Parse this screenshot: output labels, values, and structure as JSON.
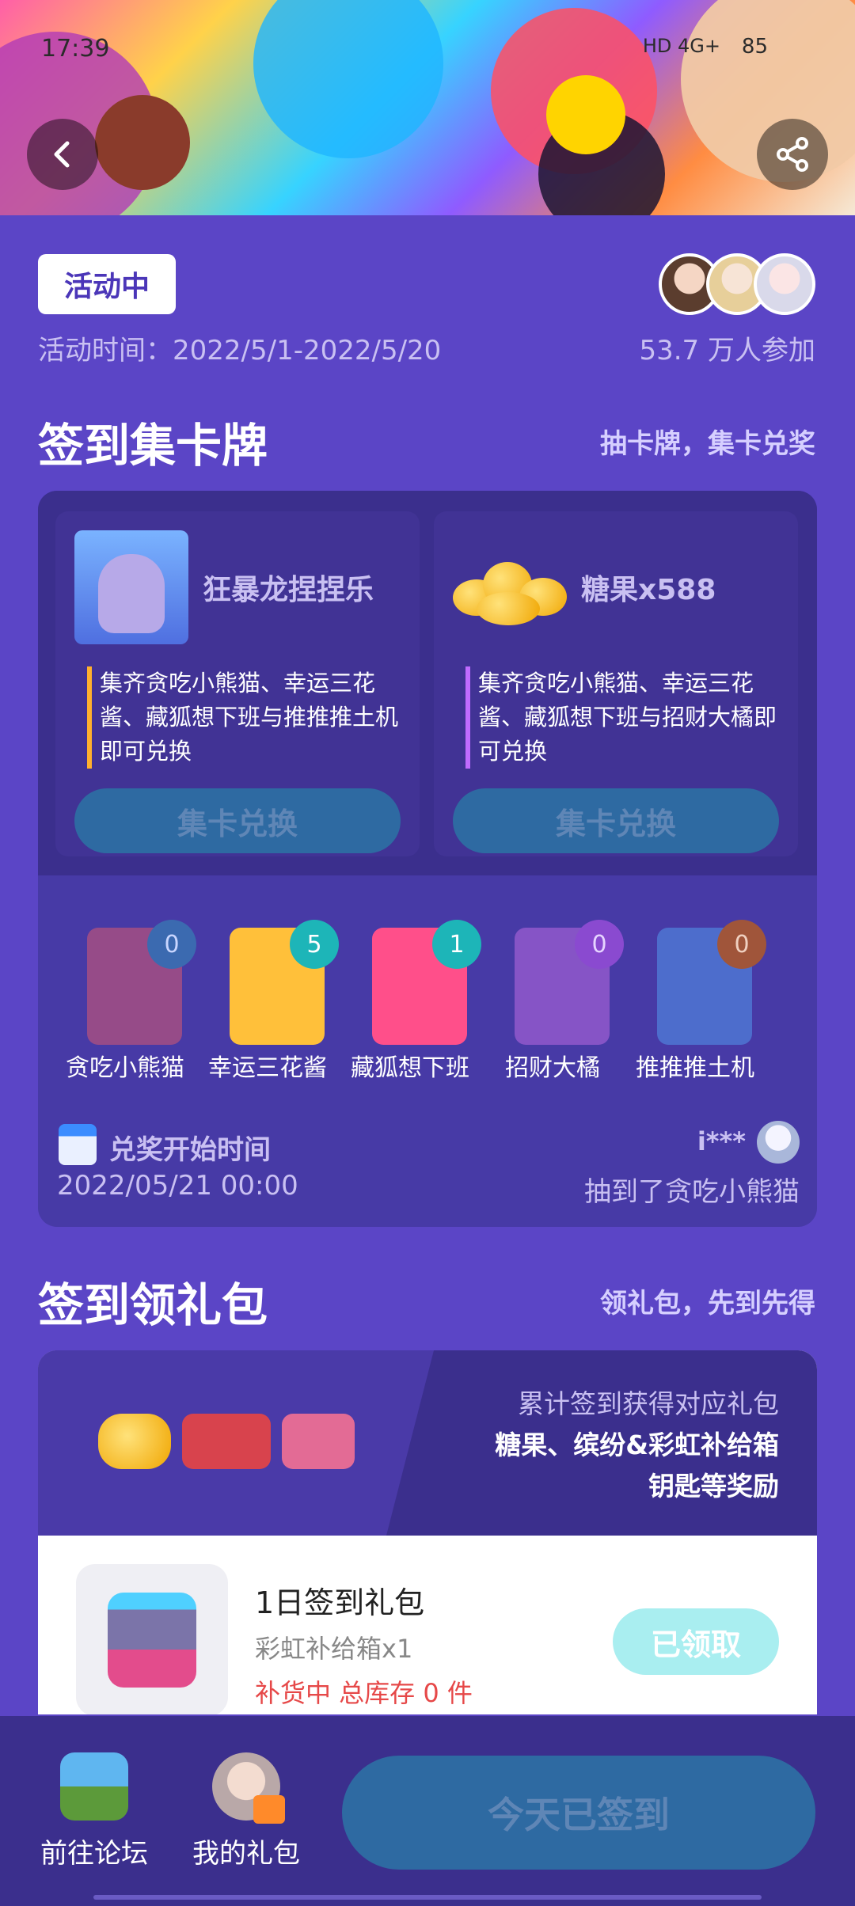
{
  "status_bar": {
    "time": "17:39",
    "network": "HD 4G+",
    "battery": "85"
  },
  "hero": {
    "back_icon": "back-arrow-icon",
    "share_icon": "share-icon"
  },
  "activity": {
    "status_tag": "活动中",
    "time_label": "活动时间：2022/5/1-2022/5/20",
    "participants": "53.7 万人参加"
  },
  "sign_cards": {
    "title": "签到集卡牌",
    "subtitle": "抽卡牌，集卡兑奖",
    "rewards": [
      {
        "name": "狂暴龙捏捏乐",
        "desc": "集齐贪吃小熊猫、幸运三花酱、藏狐想下班与推推推土机即可兑换",
        "button": "集卡兑换"
      },
      {
        "name": "糖果x588",
        "desc": "集齐贪吃小熊猫、幸运三花酱、藏狐想下班与招财大橘即可兑换",
        "button": "集卡兑换"
      }
    ],
    "cards": [
      {
        "name": "贪吃小熊猫",
        "count": "0"
      },
      {
        "name": "幸运三花酱",
        "count": "5"
      },
      {
        "name": "藏狐想下班",
        "count": "1"
      },
      {
        "name": "招财大橘",
        "count": "0"
      },
      {
        "name": "推推推土机",
        "count": "0"
      }
    ],
    "redeem_label": "兑奖开始时间",
    "redeem_time": "2022/05/21 00:00",
    "latest_draw": {
      "user": "i***",
      "text": "抽到了贪吃小熊猫"
    }
  },
  "sign_gifts": {
    "title": "签到领礼包",
    "subtitle": "领礼包，先到先得",
    "banner": {
      "line1": "累计签到获得对应礼包",
      "line2": "糖果、缤纷&彩虹补给箱",
      "line3": "钥匙等奖励"
    },
    "gift": {
      "title": "1日签到礼包",
      "content": "彩虹补给箱x1",
      "stock": "补货中 总库存 0 件",
      "button": "已领取"
    }
  },
  "bottom_bar": {
    "forum_label": "前往论坛",
    "gifts_label": "我的礼包",
    "sign_button": "今天已签到"
  },
  "colors": {
    "background": "#5b45c6",
    "panel": "#3b2f8d",
    "disabled_button": "#2e6aa2",
    "stock_red": "#e64848",
    "claimed": "#a9eef0"
  }
}
